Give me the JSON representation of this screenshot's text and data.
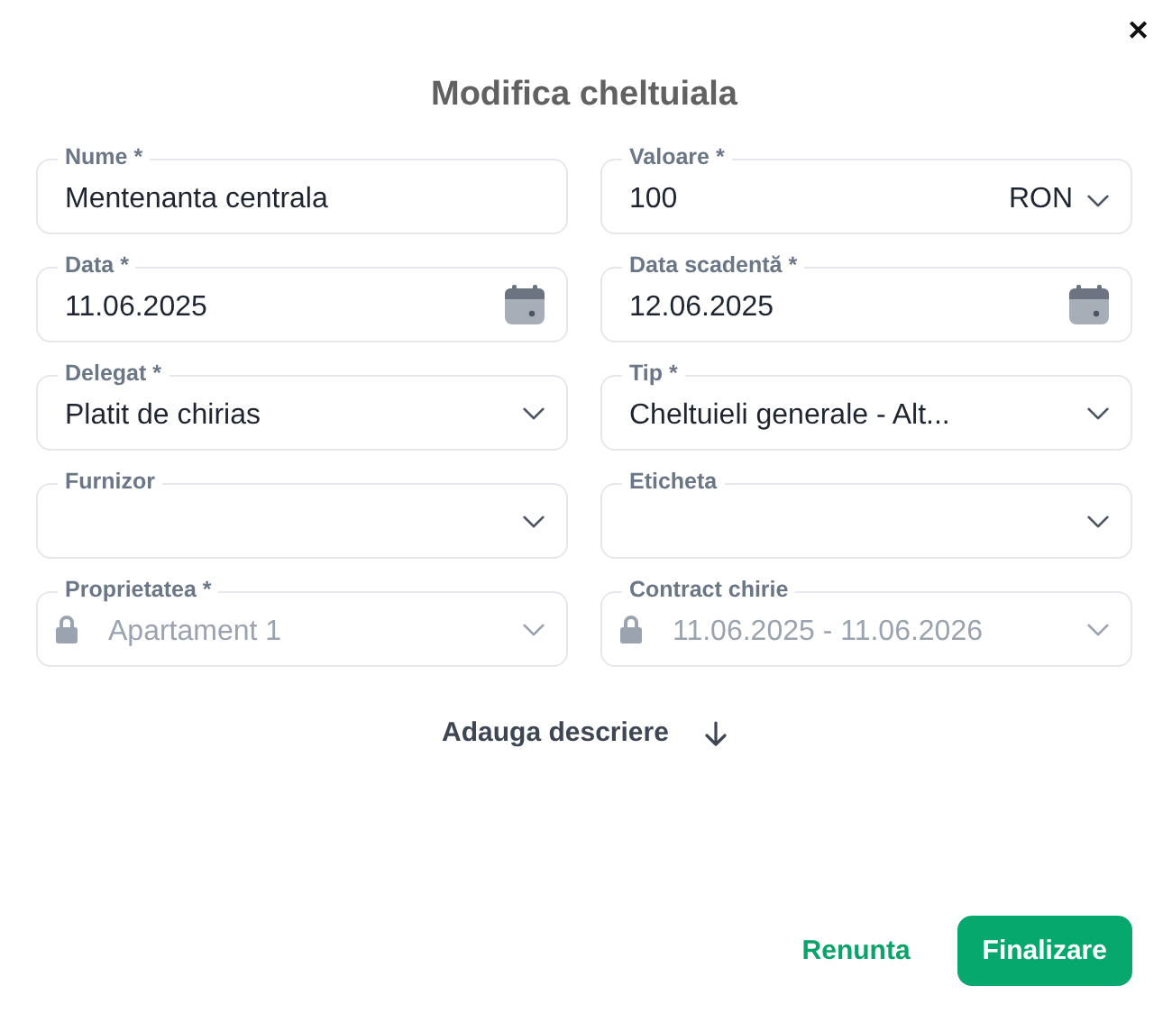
{
  "dialog": {
    "title": "Modifica cheltuiala",
    "close": "✕"
  },
  "fields": [
    {
      "kind": "text",
      "label": "Nume *",
      "value": "Mentenanta centrala",
      "disabled": false
    },
    {
      "kind": "amount",
      "label": "Valoare *",
      "value": "100",
      "currency": "RON",
      "disabled": false
    },
    {
      "kind": "date",
      "label": "Data *",
      "value": "11.06.2025",
      "disabled": false
    },
    {
      "kind": "date",
      "label": "Data scadentă *",
      "value": "12.06.2025",
      "disabled": false
    },
    {
      "kind": "select",
      "label": "Delegat *",
      "value": "Platit de chirias",
      "disabled": false
    },
    {
      "kind": "select",
      "label": "Tip *",
      "value": "Cheltuieli generale - Alt...",
      "disabled": false
    },
    {
      "kind": "select",
      "label": "Furnizor",
      "disabled": false
    },
    {
      "kind": "select",
      "label": "Eticheta",
      "disabled": false
    },
    {
      "kind": "select",
      "label": "Proprietatea *",
      "value": "Apartament 1",
      "disabled": true
    },
    {
      "kind": "select",
      "label": "Contract chirie",
      "value": "11.06.2025 - 11.06.2026",
      "disabled": true
    }
  ],
  "add_description": {
    "label": "Adauga descriere"
  },
  "buttons": [
    {
      "label": "Renunta",
      "kind": "secondary"
    },
    {
      "label": "Finalizare",
      "kind": "primary"
    }
  ]
}
